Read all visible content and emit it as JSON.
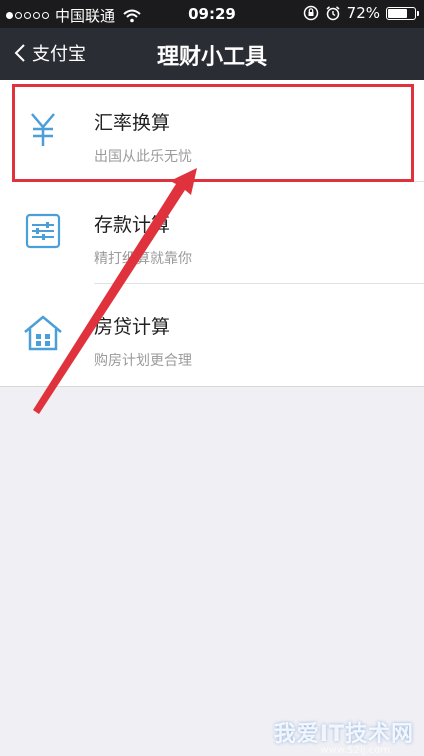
{
  "status_bar": {
    "carrier": "中国联通",
    "time": "09:29",
    "battery_percent": "72%",
    "battery_level": 0.72,
    "signal_bars_filled": 1,
    "signal_bars_total": 5
  },
  "nav": {
    "back_label": "支付宝",
    "title": "理财小工具"
  },
  "tools": [
    {
      "title": "汇率换算",
      "subtitle": "出国从此乐无忧",
      "icon": "yuan-icon"
    },
    {
      "title": "存款计算",
      "subtitle": "精打细算就靠你",
      "icon": "sliders-icon"
    },
    {
      "title": "房贷计算",
      "subtitle": "购房计划更合理",
      "icon": "house-icon"
    }
  ],
  "annotation": {
    "highlight_color": "#e0323c",
    "arrow_color": "#e0323c"
  },
  "watermark": {
    "text": "我爱IT技术网",
    "url": "www.52ij.com"
  },
  "colors": {
    "nav_bg": "#2a2d33",
    "icon_blue": "#4a9fd8",
    "page_bg": "#efeff4"
  }
}
